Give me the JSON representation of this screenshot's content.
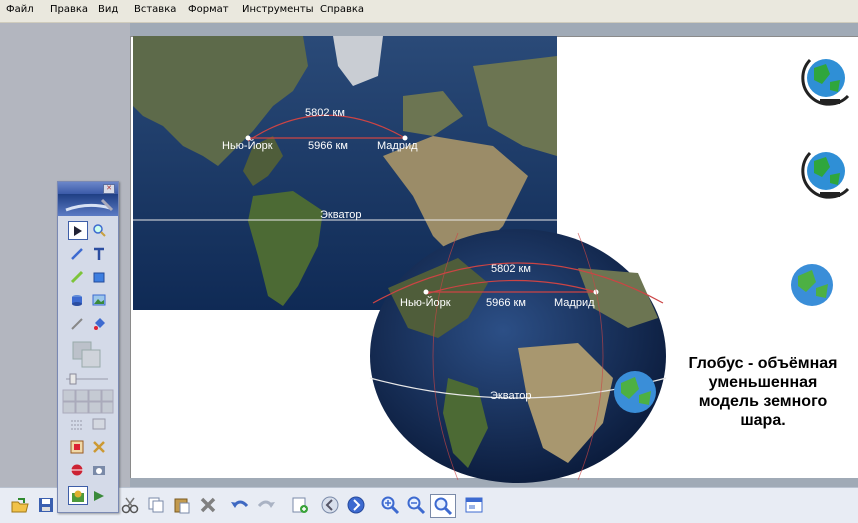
{
  "menu": [
    "Файл",
    "Правка",
    "Вид",
    "Вставка",
    "Формат",
    "Инструменты",
    "Справка"
  ],
  "map_labels": {
    "flat": {
      "arc": "5802 км",
      "city1": "Нью-Йорк",
      "straight": "5966 км",
      "city2": "Мадрид",
      "equator": "Экватор"
    },
    "globe": {
      "arc": "5802 км",
      "city1": "Нью-Йорк",
      "straight": "5966 км",
      "city2": "Мадрид",
      "equator": "Экватор"
    }
  },
  "caption": [
    "Глобус - объёмная",
    "уменьшенная",
    "модель земного",
    "шара."
  ],
  "palette": {
    "tools": [
      "select-arrow-icon",
      "zoom-icon",
      "pen-icon",
      "text-tool-icon",
      "highlighter-icon",
      "shape-tool-icon",
      "eraser-icon",
      "image-icon",
      "line-pen-icon",
      "fill-icon",
      "color-swatch-icon",
      "transparency-slider-icon",
      "grid-icon",
      "line-style-icon",
      "screen-capture-icon",
      "delete-icon",
      "globe-tool-icon",
      "camera-icon",
      "record-icon",
      "lasso-icon"
    ]
  },
  "toolbar_icons": [
    "open-icon",
    "save-icon",
    "print-icon",
    "cut-icon",
    "copy-icon",
    "paste-icon",
    "delete-icon",
    "undo-icon",
    "redo-icon",
    "insert-page-icon",
    "previous-page-icon",
    "next-page-icon",
    "zoom-in-icon",
    "zoom-out-icon",
    "zoom-fit-icon",
    "window-icon"
  ]
}
